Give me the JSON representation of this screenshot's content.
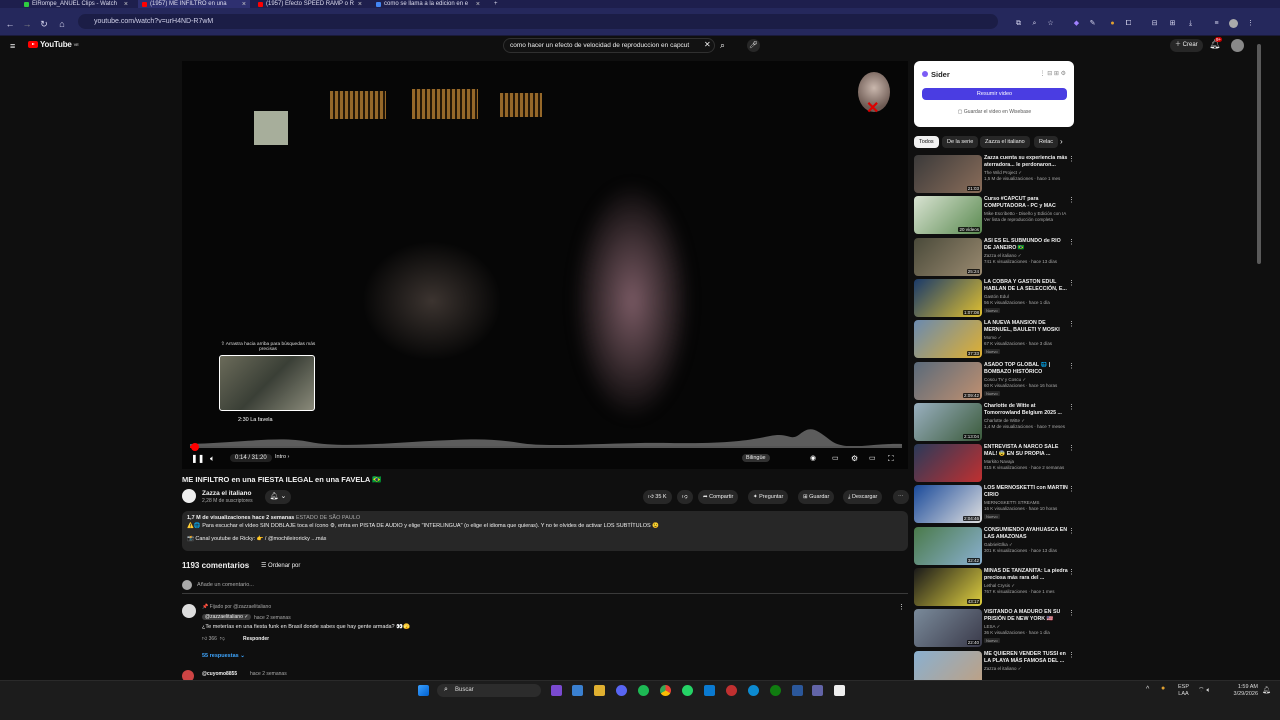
{
  "browser": {
    "tabs": [
      {
        "label": "ElRompe_ANUEL Clips - Watch",
        "color": "#2ecc40"
      },
      {
        "label": "(1957) ME INFILTRO en una",
        "color": "#ff0000"
      },
      {
        "label": "(1957) Efecto SPEED RAMP o R",
        "color": "#ff0000"
      },
      {
        "label": "como se llama a la edicion en e",
        "color": "#4285f4"
      }
    ],
    "url": "youtube.com/watch?v=urH4ND-R7wM"
  },
  "yt": {
    "logo": "YouTube",
    "country": "VE",
    "search_value": "como hacer un efecto de velocidad de reproduccion en capcut",
    "create_label": "Crear",
    "notif_count": "9+"
  },
  "player": {
    "thumb_hint": "⇧ Arrastra hacia arriba para búsquedas más precisas",
    "thumb_time": "2:30  La favela",
    "time": "0:14 / 31:20",
    "chapter": "Intro",
    "bilingual": "Bilingüe",
    "progress_fraction": 0.0074
  },
  "video": {
    "title": "ME INFILTRO en una FIESTA ILEGAL en una FAVELA 🇧🇷",
    "channel": "Zazza el italiano",
    "subs": "2,28 M de suscriptores",
    "likes": "35 K",
    "share": "Compartir",
    "ask": "Preguntar",
    "save": "Guardar",
    "download": "Descargar",
    "views_date": "1,7 M de visualizaciones  hace 2 semanas",
    "location": "ESTADO DE SÃO PAULO",
    "desc_line": "⚠️🌐 Para escuchar el vídeo SIN DOBLAJE toca el ícono ⚙, entra en PISTA DE AUDIO y elige \"INTERLINGUA\" (o elige el idioma que quieras). Y no te olvides de activar LOS SUBTÍTULOS 😉",
    "desc_line2": "📸 Canal youtube de Ricky: 👉 / @mochileiroricky  ...más"
  },
  "comments": {
    "count": "1193 comentarios",
    "order": "Ordenar por",
    "add_placeholder": "Añade un comentario...",
    "pinned": "📌 Fijado por @zazzaelitaliano",
    "c1_user": "@zazzaelitaliano ✓",
    "c1_time": "hace 2 semanas",
    "c1_text": "¿Te meterías en una fiesta funk en Brasil donde sabes que hay gente armada? 👀🫣",
    "c1_likes": "366",
    "c1_reply": "Responder",
    "c1_replies": "55 respuestas",
    "c2_user": "@cuyomo8855",
    "c2_time": "hace 2 semanas"
  },
  "sider": {
    "title": "Sider",
    "button": "Resumir video",
    "link": "Guardar el video en Wisebase"
  },
  "chips": [
    "Todos",
    "De la serie",
    "Zazza el italiano",
    "Relac"
  ],
  "related": [
    {
      "title": "Zazza cuenta su experiencia más aterradora... le perdonaron...",
      "channel": "The Wild Project ✓",
      "views": "1,5 M de visualizaciones · hace 1 mes",
      "dur": "21:03",
      "c1": "#3b3a3a",
      "c2": "#8a6d5a"
    },
    {
      "title": "Curso #CAPCUT para COMPUTADORA - PC y MAC",
      "channel": "Mike Escribetto - Diseño y Edición con IA",
      "views": "Ver lista de reproducción completa",
      "dur": "20 vídeos",
      "c1": "#d9e3d2",
      "c2": "#5a8a50"
    },
    {
      "title": "ASÍ ES EL SUBMUNDO de RIO DE JANEIRO 🇧🇷",
      "channel": "Zazza el italiano ✓",
      "views": "741 K visualizaciones · hace 13 días",
      "dur": "25:24",
      "c1": "#4a4a3a",
      "c2": "#9a8a70"
    },
    {
      "title": "LA COBRA Y GASTÓN EDUL HABLAN DE LA SELECCIÓN, E...",
      "channel": "Gastón Edul",
      "views": "56 K visualizaciones · hace 1 día",
      "dur": "1:07:08",
      "c1": "#1a3a6a",
      "c2": "#e0c030",
      "nuevo": "Nuevo"
    },
    {
      "title": "LA NUEVA MANSIÓN DE MERNUEL, BAULETI Y MOSKI",
      "channel": "Momo ✓",
      "views": "67 K visualizaciones · hace 3 días",
      "dur": "37:33",
      "c1": "#6a8ab0",
      "c2": "#e0b030",
      "nuevo": "Nuevo"
    },
    {
      "title": "ASADO TOP GLOBAL 🌐 | BOMBAZO HISTÓRICO",
      "channel": "Coscu TV y Coscu ✓",
      "views": "60 K visualizaciones · hace 16 horas",
      "dur": "2:09:42",
      "c1": "#5a6a7a",
      "c2": "#c09070",
      "nuevo": "Nuevo"
    },
    {
      "title": "Charlotte de Witte at Tomorrowland Belgium 2025 ...",
      "channel": "Charlotte de Witte ✓",
      "views": "1,4 M de visualizaciones · hace 7 meses",
      "dur": "2:13:04",
      "c1": "#9ab0c0",
      "c2": "#3a5a3a"
    },
    {
      "title": "ENTREVISTA A NARCO SALE MAL! 😨 EN SU PROPIA ...",
      "channel": "Markito Navaja",
      "views": "815 K visualizaciones · hace 2 semanas",
      "dur": "",
      "c1": "#2a3a5a",
      "c2": "#c03030"
    },
    {
      "title": "LOS MERNOSKETTI con MARTÍN CIRIO",
      "channel": "MERNOSKETTI STREAMS",
      "views": "16 K visualizaciones · hace 10 horas",
      "dur": "2:04:46",
      "c1": "#1a4a9a",
      "c2": "#e0e0e0",
      "nuevo": "Nuevo"
    },
    {
      "title": "CONSUMIENDO AYAHUASCA EN LAS AMAZONAS",
      "channel": "GabrielGlka ✓",
      "views": "301 K visualizaciones · hace 13 días",
      "dur": "32:42",
      "c1": "#4a7a4a",
      "c2": "#8ab0d0"
    },
    {
      "title": "MINAS DE TANZANITA: La piedra preciosa más rara del ...",
      "channel": "Lethal Crysis ✓",
      "views": "767 K visualizaciones · hace 1 mes",
      "dur": "43:17",
      "c1": "#1a1a1a",
      "c2": "#e0d040"
    },
    {
      "title": "VISITANDO A MADURO EN SU PRISIÓN DE NEW YORK 🇺🇸",
      "channel": "LESA ✓",
      "views": "36 K visualizaciones · hace 1 día",
      "dur": "22:40",
      "c1": "#7a8a9a",
      "c2": "#3a3a4a",
      "nuevo": "Nuevo"
    },
    {
      "title": "ME QUIEREN VENDER TUSSI en LA PLAYA MÁS FAMOSA DEL ...",
      "channel": "Zazza el italiano ✓",
      "views": "",
      "dur": "",
      "c1": "#8ab0d0",
      "c2": "#c0a080"
    }
  ],
  "taskbar": {
    "search": "Buscar",
    "lang": "ESP",
    "lang2": "LAA",
    "time": "1:59 AM",
    "date": "3/29/2026"
  }
}
